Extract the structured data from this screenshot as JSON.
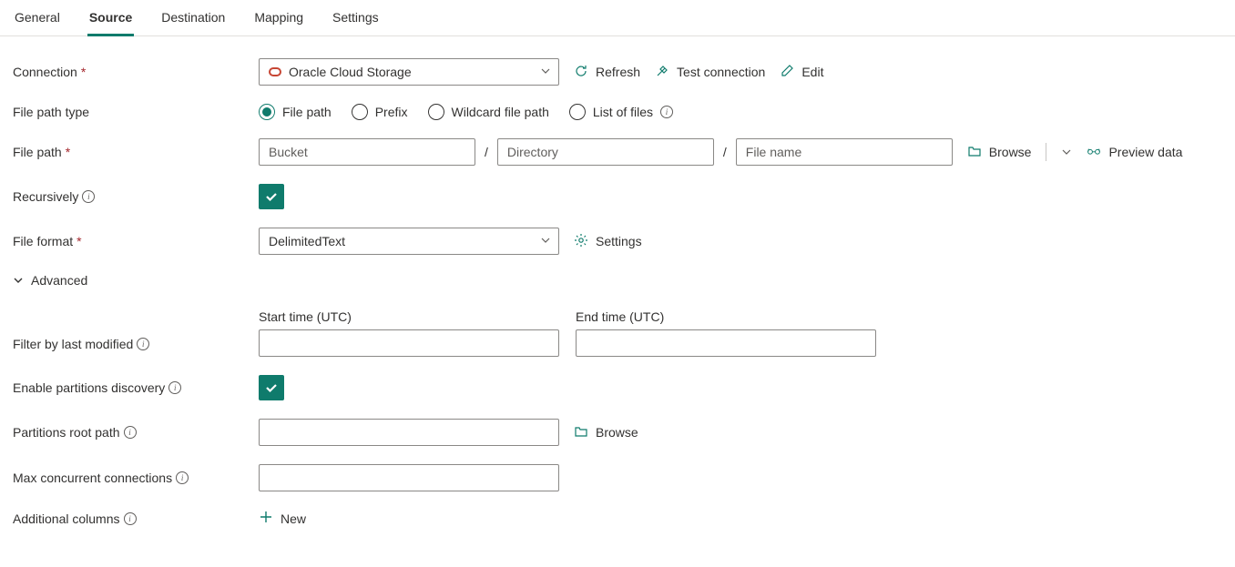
{
  "tabs": {
    "general": "General",
    "source": "Source",
    "destination": "Destination",
    "mapping": "Mapping",
    "settings": "Settings"
  },
  "labels": {
    "connection": "Connection",
    "file_path_type": "File path type",
    "file_path": "File path",
    "recursively": "Recursively",
    "file_format": "File format",
    "advanced": "Advanced",
    "start_time": "Start time (UTC)",
    "end_time": "End time (UTC)",
    "filter_by_last_modified": "Filter by last modified",
    "enable_partitions_discovery": "Enable partitions discovery",
    "partitions_root_path": "Partitions root path",
    "max_concurrent_connections": "Max concurrent connections",
    "additional_columns": "Additional columns"
  },
  "connection": {
    "value": "Oracle Cloud Storage",
    "refresh": "Refresh",
    "test": "Test connection",
    "edit": "Edit"
  },
  "file_path_type": {
    "options": {
      "file_path": "File path",
      "prefix": "Prefix",
      "wildcard": "Wildcard file path",
      "list": "List of files"
    }
  },
  "file_path": {
    "bucket_placeholder": "Bucket",
    "directory_placeholder": "Directory",
    "filename_placeholder": "File name",
    "browse": "Browse",
    "preview": "Preview data"
  },
  "file_format": {
    "value": "DelimitedText",
    "settings": "Settings"
  },
  "partitions": {
    "browse": "Browse"
  },
  "additional_columns": {
    "new": "New"
  }
}
